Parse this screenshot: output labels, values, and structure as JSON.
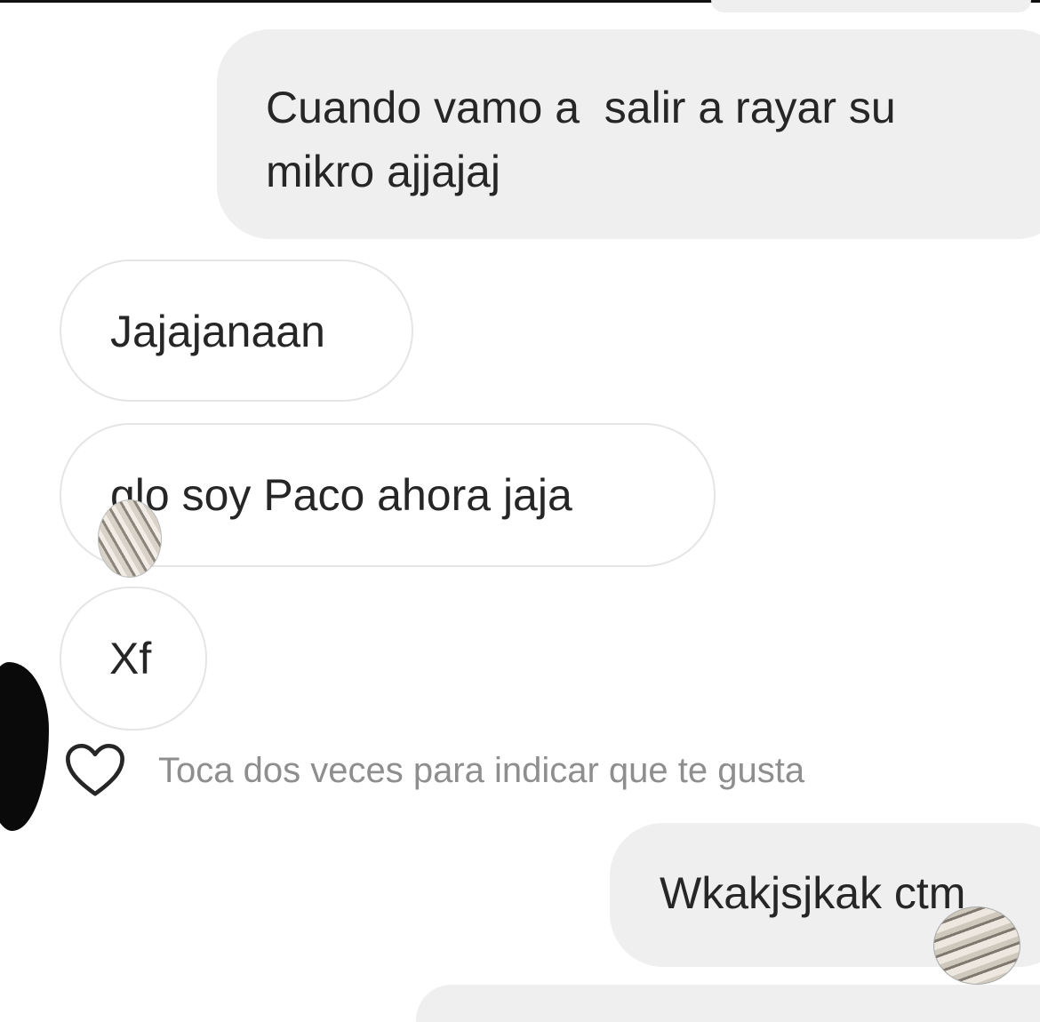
{
  "messages": [
    {
      "id": "msg1",
      "direction": "outgoing",
      "lines": [
        "Cuando vamo a  salir a rayar su",
        "mikro ajjajaj"
      ]
    },
    {
      "id": "msg2",
      "direction": "incoming",
      "text": "Jajajanaan"
    },
    {
      "id": "msg3",
      "direction": "incoming",
      "text": "glo soy Paco ahora jaja"
    },
    {
      "id": "msg4",
      "direction": "incoming",
      "text": "Xf"
    },
    {
      "id": "msg5",
      "direction": "outgoing",
      "text": "Wkakjsjkak ctm"
    }
  ],
  "like_hint": {
    "icon": "heart-icon",
    "text": "Toca dos veces para indicar que te gusta"
  },
  "colors": {
    "outgoing_bubble": "#efefef",
    "incoming_border": "#e5e5e5",
    "text": "#262626",
    "hint_text": "#8e8e8e"
  }
}
